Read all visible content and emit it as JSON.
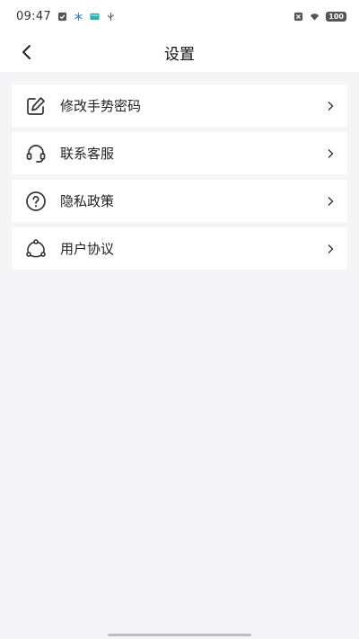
{
  "status_bar": {
    "time": "09:47",
    "left_icons": [
      "check-square-icon",
      "snowflake-icon",
      "app-badge-icon",
      "usb-icon"
    ],
    "right_icons": [
      "close-box-icon",
      "wifi-icon"
    ],
    "battery": "100"
  },
  "header": {
    "title": "设置",
    "back_icon": "chevron-left-icon"
  },
  "settings": {
    "items": [
      {
        "label": "修改手势密码",
        "icon": "edit-icon"
      },
      {
        "label": "联系客服",
        "icon": "headset-icon"
      },
      {
        "label": "隐私政策",
        "icon": "question-circle-icon"
      },
      {
        "label": "用户协议",
        "icon": "share-nodes-icon"
      }
    ]
  },
  "colors": {
    "background": "#f5f5f7",
    "card": "#ffffff",
    "text": "#222222"
  }
}
